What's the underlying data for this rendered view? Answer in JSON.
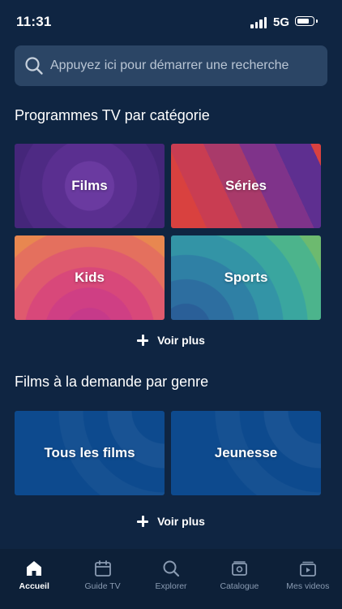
{
  "status_bar": {
    "time": "11:31",
    "network": "5G"
  },
  "search": {
    "placeholder": "Appuyez ici pour démarrer une recherche",
    "icon": "search-icon"
  },
  "tv_section": {
    "title": "Programmes TV par catégorie",
    "tiles": [
      {
        "label": "Films"
      },
      {
        "label": "Séries"
      },
      {
        "label": "Kids"
      },
      {
        "label": "Sports"
      }
    ],
    "more_label": "Voir plus"
  },
  "vod_section": {
    "title": "Films à la demande par genre",
    "tiles": [
      {
        "label": "Tous les films"
      },
      {
        "label": "Jeunesse"
      }
    ],
    "more_label": "Voir plus"
  },
  "tab_bar": {
    "tabs": [
      {
        "label": "Accueil",
        "icon": "home-icon",
        "active": true
      },
      {
        "label": "Guide TV",
        "icon": "calendar-icon",
        "active": false
      },
      {
        "label": "Explorer",
        "icon": "search-icon",
        "active": false
      },
      {
        "label": "Catalogue",
        "icon": "catalogue-icon",
        "active": false
      },
      {
        "label": "Mes videos",
        "icon": "video-library-icon",
        "active": false
      }
    ]
  },
  "colors": {
    "background": "#0f2542",
    "search_field": "#2b4565",
    "tab_bar": "#0d2038",
    "tab_inactive": "#8a9bb2",
    "vod_tile": "#0d4a8e"
  }
}
